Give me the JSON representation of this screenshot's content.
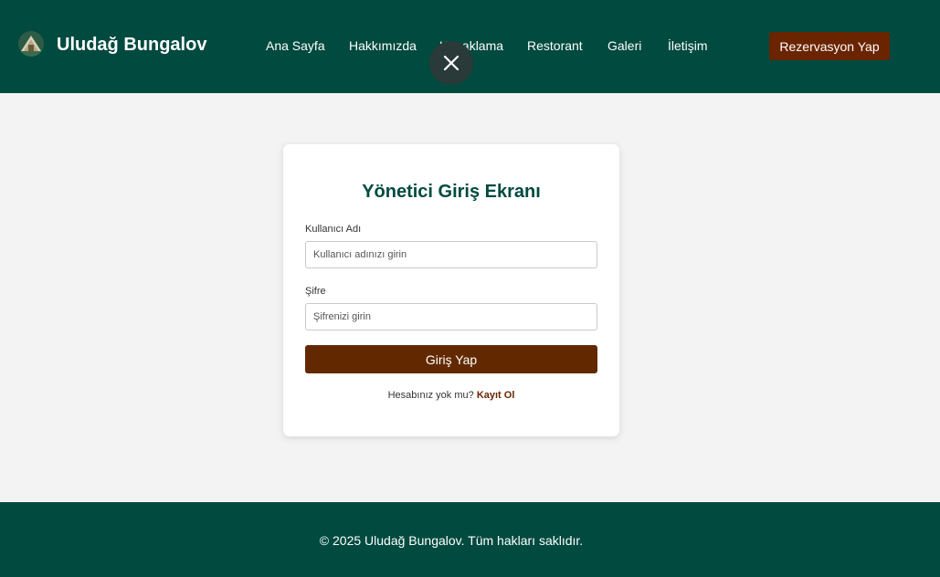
{
  "header": {
    "brand": "Uludağ Bungalov",
    "nav": [
      "Ana Sayfa",
      "Hakkımızda",
      "Konaklama",
      "Restorant",
      "Galeri",
      "İletişim"
    ],
    "reserve_label": "Rezervasyon Yap",
    "colors": {
      "background": "#004a3f",
      "accent": "#6a2400"
    }
  },
  "overlay": {
    "close_icon": "close-icon"
  },
  "login": {
    "title": "Yönetici Giriş Ekranı",
    "username_label": "Kullanıcı Adı",
    "username_placeholder": "Kullanıcı adınızı girin",
    "username_value": "",
    "password_label": "Şifre",
    "password_placeholder": "Şifrenizi girin",
    "password_value": "",
    "submit_label": "Giriş Yap",
    "register_prompt": "Hesabınız yok mu?",
    "register_link": "Kayıt Ol"
  },
  "footer": {
    "text": "© 2025 Uludağ Bungalov. Tüm hakları saklıdır."
  }
}
